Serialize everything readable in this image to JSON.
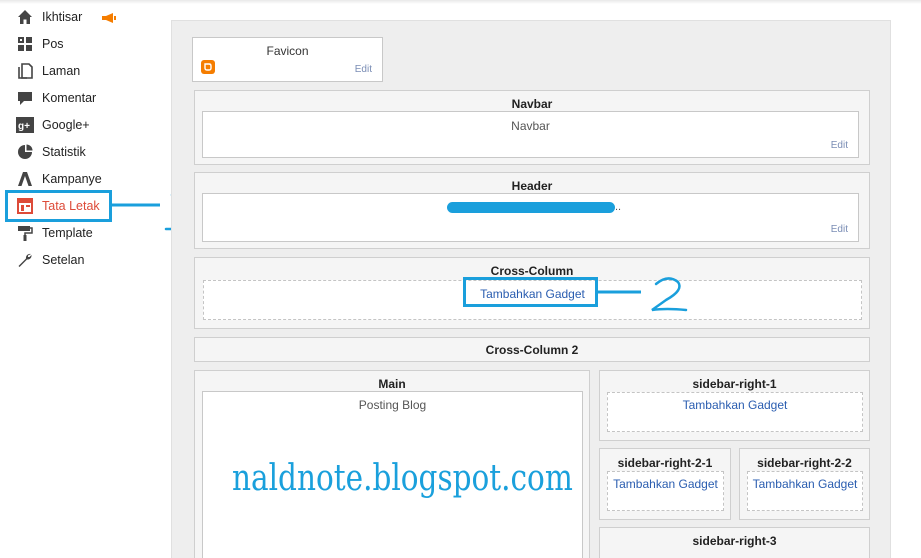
{
  "sidebar": {
    "items": [
      {
        "label": "Ikhtisar",
        "icon": "home-icon"
      },
      {
        "label": "Pos",
        "icon": "posts-icon"
      },
      {
        "label": "Laman",
        "icon": "pages-icon"
      },
      {
        "label": "Komentar",
        "icon": "comment-icon"
      },
      {
        "label": "Google+",
        "icon": "google-plus-icon"
      },
      {
        "label": "Statistik",
        "icon": "pie-chart-icon"
      },
      {
        "label": "Kampanye",
        "icon": "campaign-icon"
      },
      {
        "label": "Tata Letak",
        "icon": "layout-icon",
        "active": true
      },
      {
        "label": "Template",
        "icon": "paint-roller-icon"
      },
      {
        "label": "Setelan",
        "icon": "wrench-icon"
      }
    ]
  },
  "layout": {
    "favicon": {
      "title": "Favicon",
      "edit": "Edit"
    },
    "navbar": {
      "section": "Navbar",
      "gadget": "Navbar",
      "edit": "Edit"
    },
    "header": {
      "section": "Header",
      "gadget_suffix": "..",
      "edit": "Edit"
    },
    "cross_column": {
      "section": "Cross-Column",
      "add": "Tambahkan Gadget"
    },
    "cross_column_2": {
      "section": "Cross-Column 2"
    },
    "main": {
      "section": "Main",
      "gadget": "Posting Blog"
    },
    "sidebar_right_1": {
      "section": "sidebar-right-1",
      "add": "Tambahkan Gadget"
    },
    "sidebar_right_2_1": {
      "section": "sidebar-right-2-1",
      "add": "Tambahkan Gadget"
    },
    "sidebar_right_2_2": {
      "section": "sidebar-right-2-2",
      "add": "Tambahkan Gadget"
    },
    "sidebar_right_3": {
      "section": "sidebar-right-3"
    }
  },
  "watermark": "naldnote.blogspot.com",
  "colors": {
    "accent": "#dd4b39",
    "annotation": "#1a9fdc",
    "link": "#2a5db0",
    "blogger": "#f57d00"
  }
}
